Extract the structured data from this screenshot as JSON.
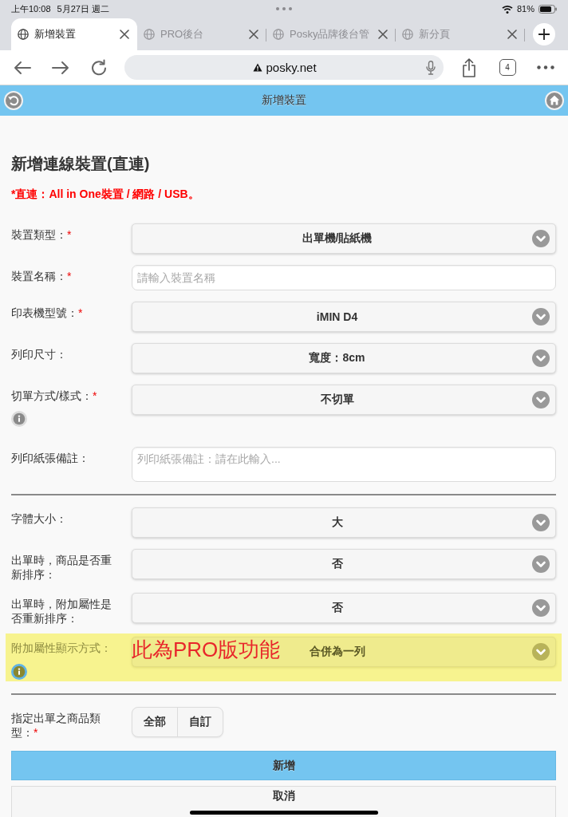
{
  "status_bar": {
    "time": "上午10:08",
    "date": "5月27日 週二",
    "battery": "81%"
  },
  "browser_tabs": [
    {
      "title": "新增裝置",
      "selected": true
    },
    {
      "title": "PRO後台",
      "selected": false
    },
    {
      "title": "Posky品牌後台管",
      "selected": false
    },
    {
      "title": "新分頁",
      "selected": false
    }
  ],
  "toolbar": {
    "url": "posky.net",
    "tab_count": "4"
  },
  "app_header": {
    "title": "新增裝置"
  },
  "form": {
    "title": "新增連線裝置(直連)",
    "note": "*直連：All in One裝置 / 網路 / USB。",
    "sections": [
      {
        "fields": [
          {
            "kind": "select",
            "label": "裝置類型：",
            "required_mark": "*",
            "highlighted": false,
            "info": false,
            "value": "出單機/貼紙機"
          },
          {
            "kind": "input",
            "label": "裝置名稱：",
            "required_mark": "*",
            "highlighted": false,
            "info": false,
            "placeholder": "請輸入裝置名稱"
          },
          {
            "kind": "select",
            "label": "印表機型號：",
            "required_mark": "*",
            "highlighted": false,
            "info": false,
            "value": "iMIN D4"
          },
          {
            "kind": "select",
            "label": "列印尺寸：",
            "highlighted": false,
            "info": false,
            "value": "寬度：8cm"
          },
          {
            "kind": "select",
            "label": "切單方式/樣式：",
            "required_mark": "*",
            "highlighted": false,
            "info": true,
            "info_focused": false,
            "value": "不切單"
          },
          {
            "kind": "textarea",
            "label": "列印紙張備註：",
            "highlighted": false,
            "info": false,
            "placeholder": "列印紙張備註：請在此輸入..."
          }
        ]
      },
      {
        "fields": [
          {
            "kind": "select",
            "label": "字體大小：",
            "highlighted": false,
            "info": false,
            "value": "大"
          },
          {
            "kind": "select",
            "label": "出單時，商品是否重新排序：",
            "highlighted": false,
            "info": false,
            "value": "否"
          },
          {
            "kind": "select",
            "label": "出單時，附加屬性是否重新排序：",
            "highlighted": false,
            "info": false,
            "value": "否"
          },
          {
            "kind": "select",
            "label": "附加屬性顯示方式：",
            "highlighted": true,
            "info": true,
            "info_focused": true,
            "value": "合併為一列",
            "annotation": "此為PRO版功能"
          }
        ]
      },
      {
        "fields": [
          {
            "kind": "segmented",
            "label": "指定出單之商品類型：",
            "required_mark": "*",
            "highlighted": false,
            "info": false,
            "options": [
              "全部",
              "自訂"
            ]
          }
        ]
      }
    ]
  },
  "buttons": [
    {
      "label": "新增",
      "kind": "primary"
    },
    {
      "label": "取消",
      "kind": "secondary"
    }
  ]
}
